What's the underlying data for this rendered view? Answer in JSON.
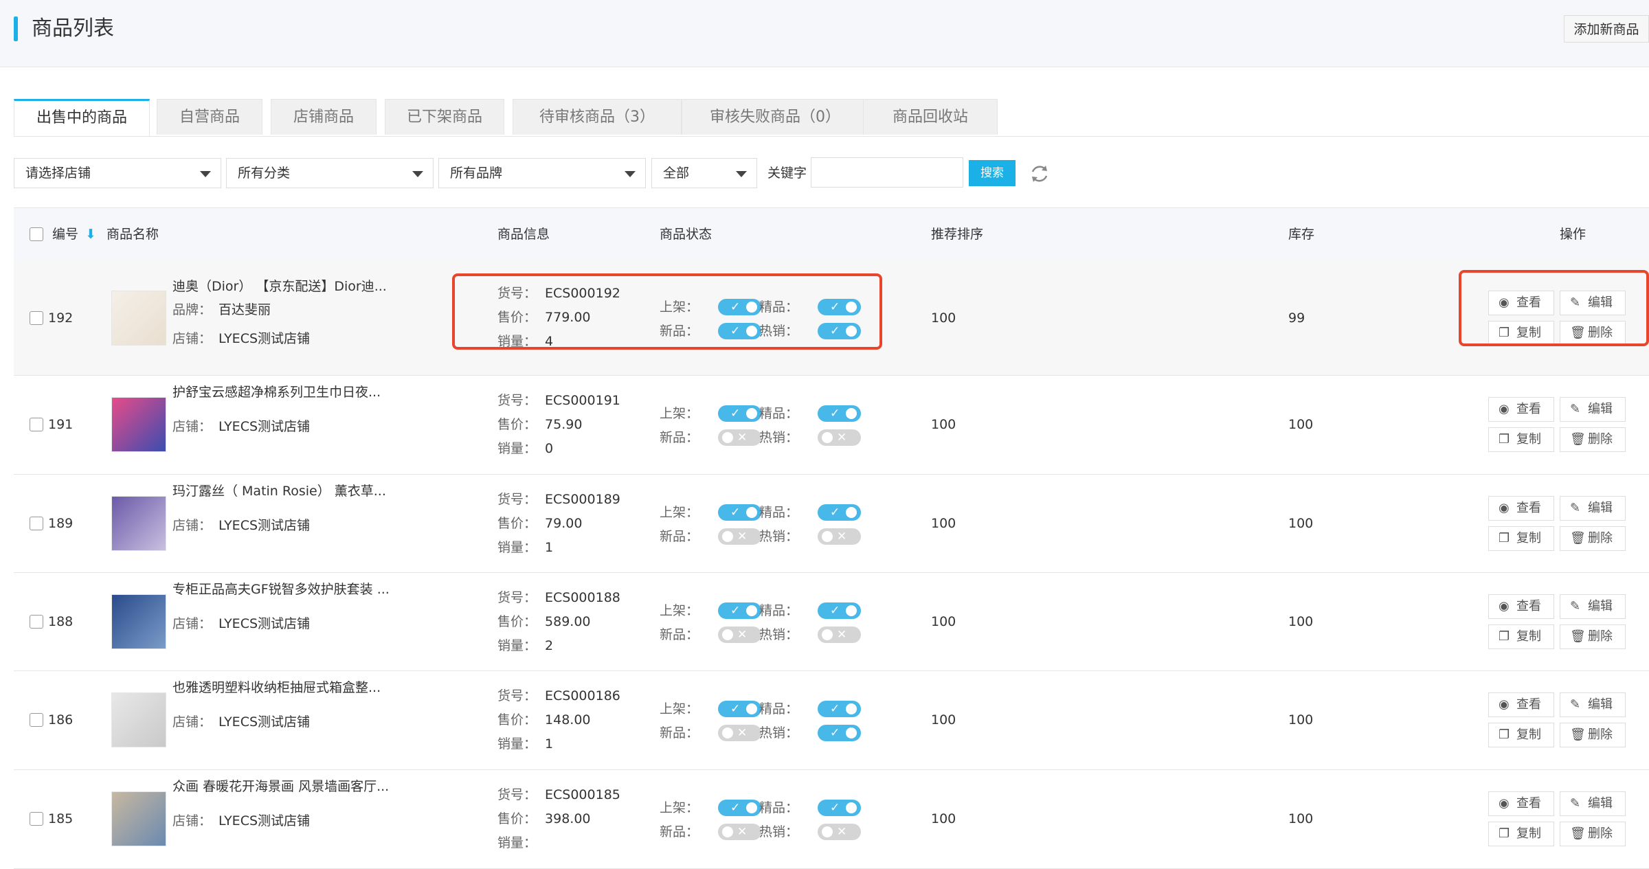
{
  "header": {
    "title": "商品列表",
    "add_button": "添加新商品"
  },
  "tabs": [
    "出售中的商品",
    "自营商品",
    "店铺商品",
    "已下架商品",
    "待审核商品（3）",
    "审核失败商品（0）",
    "商品回收站"
  ],
  "filters": {
    "shop": "请选择店铺",
    "category": "所有分类",
    "brand": "所有品牌",
    "status": "全部",
    "keyword_label": "关键字",
    "keyword_value": "",
    "search_button": "搜索"
  },
  "table": {
    "headers": {
      "id": "编号",
      "name": "商品名称",
      "info": "商品信息",
      "status": "商品状态",
      "sort": "推荐排序",
      "stock": "库存",
      "ops": "操作"
    },
    "labels": {
      "sku": "货号：",
      "price": "售价：",
      "sales": "销量：",
      "brand": "品牌：",
      "shop": "店铺：",
      "on_sale": "上架：",
      "best": "精品：",
      "new": "新品：",
      "hot": "热销："
    },
    "ops": {
      "view": "查看",
      "edit": "编辑",
      "copy": "复制",
      "delete": "删除"
    },
    "rows": [
      {
        "id": "192",
        "name": "迪奥（Dior） 【京东配送】Dior迪...",
        "brand": "百达斐丽",
        "shop": "LYECS测试店铺",
        "sku": "ECS000192",
        "price": "779.00",
        "sales": "4",
        "on_sale": true,
        "best": true,
        "new": true,
        "hot": true,
        "sort": "100",
        "stock": "99"
      },
      {
        "id": "191",
        "name": "护舒宝云感超净棉系列卫生巾日夜...",
        "brand": "",
        "shop": "LYECS测试店铺",
        "sku": "ECS000191",
        "price": "75.90",
        "sales": "0",
        "on_sale": true,
        "best": true,
        "new": false,
        "hot": false,
        "sort": "100",
        "stock": "100"
      },
      {
        "id": "189",
        "name": "玛汀露丝（ Matin Rosie） 薰衣草...",
        "brand": "",
        "shop": "LYECS测试店铺",
        "sku": "ECS000189",
        "price": "79.00",
        "sales": "1",
        "on_sale": true,
        "best": true,
        "new": false,
        "hot": false,
        "sort": "100",
        "stock": "100"
      },
      {
        "id": "188",
        "name": "专柜正品高夫GF锐智多效护肤套装 ...",
        "brand": "",
        "shop": "LYECS测试店铺",
        "sku": "ECS000188",
        "price": "589.00",
        "sales": "2",
        "on_sale": true,
        "best": true,
        "new": false,
        "hot": false,
        "sort": "100",
        "stock": "100"
      },
      {
        "id": "186",
        "name": "也雅透明塑料收纳柜抽屉式箱盒整...",
        "brand": "",
        "shop": "LYECS测试店铺",
        "sku": "ECS000186",
        "price": "148.00",
        "sales": "1",
        "on_sale": true,
        "best": true,
        "new": false,
        "hot": true,
        "sort": "100",
        "stock": "100"
      },
      {
        "id": "185",
        "name": "众画 春暖花开海景画 风景墙画客厅...",
        "brand": "",
        "shop": "LYECS测试店铺",
        "sku": "ECS000185",
        "price": "398.00",
        "sales": "",
        "on_sale": true,
        "best": true,
        "new": false,
        "hot": false,
        "sort": "100",
        "stock": "100"
      }
    ]
  },
  "colors": {
    "accent": "#1bb1e6",
    "toggle_on": "#48b8e8",
    "highlight_box": "#e8452c"
  }
}
